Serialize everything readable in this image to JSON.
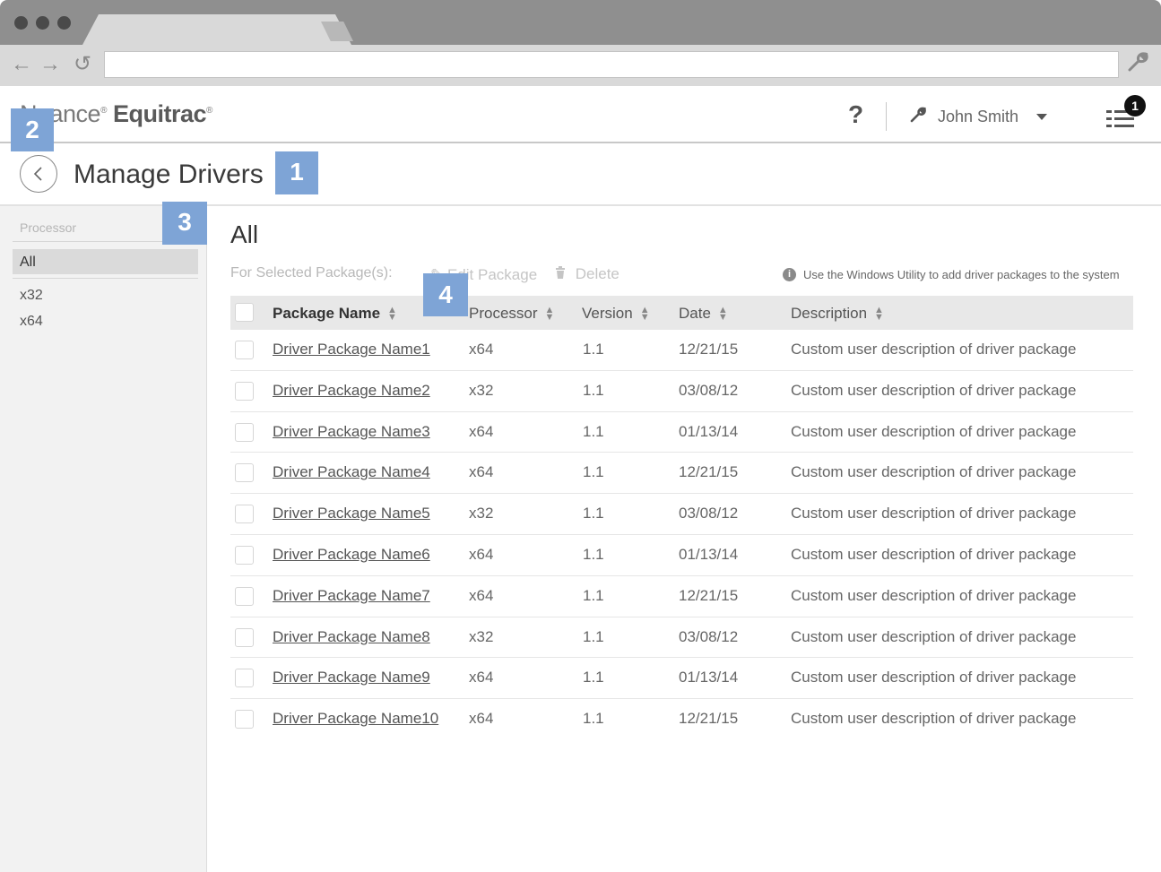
{
  "browser": {
    "back_glyph": "←",
    "forward_glyph": "→",
    "reload_glyph": "↺",
    "wrench_glyph": "🔧"
  },
  "header": {
    "logo_prefix": "Nuance",
    "logo_brand": "Equitrac",
    "help": "?",
    "user_name": "John Smith",
    "notifications_count": "1"
  },
  "page": {
    "title": "Manage Drivers"
  },
  "callouts": {
    "c1": "1",
    "c2": "2",
    "c3": "3",
    "c4": "4"
  },
  "sidebar": {
    "filter_placeholder": "Processor",
    "items": [
      {
        "label": "All"
      },
      {
        "label": "x32"
      },
      {
        "label": "x64"
      }
    ]
  },
  "main": {
    "heading": "All",
    "toolbar": {
      "selected_label": "For Selected Package(s):",
      "edit_label": "Edit Package",
      "delete_label": "Delete",
      "info_text": "Use the Windows Utility to add driver packages to the system"
    },
    "columns": {
      "name": "Package Name",
      "processor": "Processor",
      "version": "Version",
      "date": "Date",
      "description": "Description"
    },
    "rows": [
      {
        "name": "Driver Package Name1",
        "processor": "x64",
        "version": "1.1",
        "date": "12/21/15",
        "description": "Custom user description of driver package"
      },
      {
        "name": "Driver Package Name2",
        "processor": "x32",
        "version": "1.1",
        "date": "03/08/12",
        "description": "Custom user description of driver package"
      },
      {
        "name": "Driver Package Name3",
        "processor": "x64",
        "version": "1.1",
        "date": "01/13/14",
        "description": "Custom user description of driver package"
      },
      {
        "name": "Driver Package Name4",
        "processor": "x64",
        "version": "1.1",
        "date": "12/21/15",
        "description": "Custom user description of driver package"
      },
      {
        "name": "Driver Package Name5",
        "processor": "x32",
        "version": "1.1",
        "date": "03/08/12",
        "description": "Custom user description of driver package"
      },
      {
        "name": "Driver Package Name6",
        "processor": "x64",
        "version": "1.1",
        "date": "01/13/14",
        "description": "Custom user description of driver package"
      },
      {
        "name": "Driver Package Name7",
        "processor": "x64",
        "version": "1.1",
        "date": "12/21/15",
        "description": "Custom user description of driver package"
      },
      {
        "name": "Driver Package Name8",
        "processor": "x32",
        "version": "1.1",
        "date": "03/08/12",
        "description": "Custom user description of driver package"
      },
      {
        "name": "Driver Package Name9",
        "processor": "x64",
        "version": "1.1",
        "date": "01/13/14",
        "description": "Custom user description of driver package"
      },
      {
        "name": "Driver Package Name10",
        "processor": "x64",
        "version": "1.1",
        "date": "12/21/15",
        "description": "Custom user description of driver package"
      }
    ]
  }
}
